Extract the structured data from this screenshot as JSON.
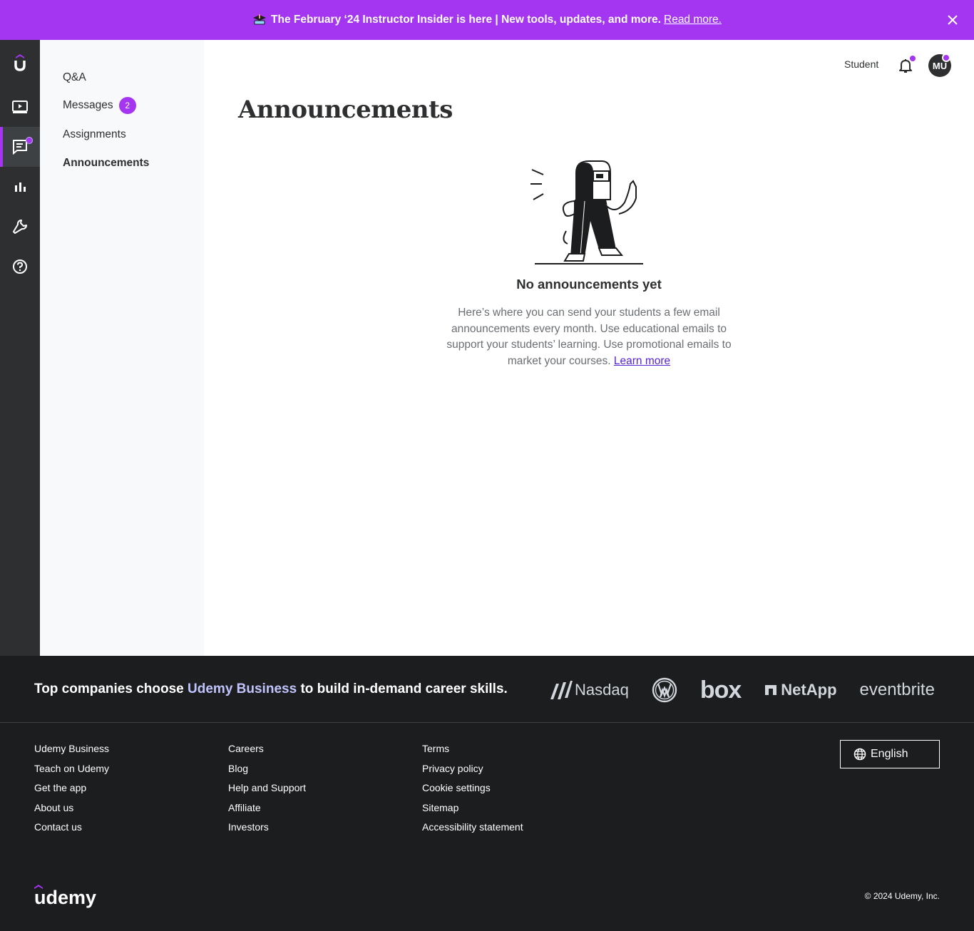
{
  "banner": {
    "text": "The February ‘24 Instructor Insider is here | New tools, updates, and more.",
    "link": "Read more."
  },
  "subnav": {
    "items": [
      {
        "label": "Q&A"
      },
      {
        "label": "Messages",
        "badge": "2"
      },
      {
        "label": "Assignments"
      },
      {
        "label": "Announcements"
      }
    ]
  },
  "topbar": {
    "student_label": "Student",
    "avatar_initials": "MU"
  },
  "main": {
    "title": "Announcements",
    "empty_title": "No announcements yet",
    "empty_desc": "Here’s where you can send your students a few email announcements every month. Use educational emails to support your students’ learning. Use promotional emails to market your courses.",
    "learn_more": "Learn more"
  },
  "footer": {
    "tagline_before": "Top companies choose",
    "tagline_link": "Udemy Business",
    "tagline_after": "to build in-demand career skills.",
    "partner_logos": [
      "Nasdaq",
      "Volkswagen",
      "box",
      "NetApp",
      "eventbrite"
    ],
    "col1": [
      "Udemy Business",
      "Teach on Udemy",
      "Get the app",
      "About us",
      "Contact us"
    ],
    "col2": [
      "Careers",
      "Blog",
      "Help and Support",
      "Affiliate",
      "Investors"
    ],
    "col3": [
      "Terms",
      "Privacy policy",
      "Cookie settings",
      "Sitemap",
      "Accessibility statement"
    ],
    "language": "English",
    "copyright": "© 2024 Udemy, Inc.",
    "brand": "udemy"
  },
  "colors": {
    "accent": "#a435f0",
    "dark": "#2d2f31",
    "footer_bg": "#1c1d1f",
    "link": "#5624d0"
  }
}
